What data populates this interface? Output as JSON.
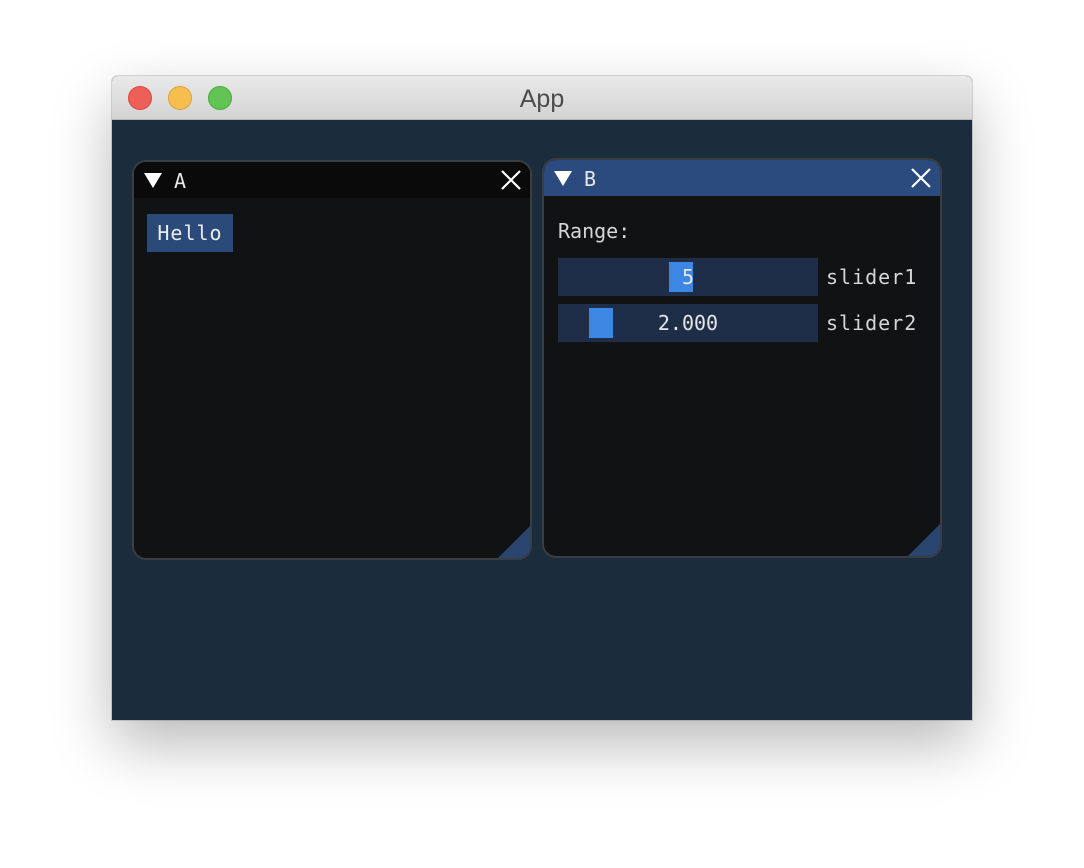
{
  "app": {
    "title": "App"
  },
  "window_controls": [
    "close",
    "minimize",
    "maximize"
  ],
  "colors": {
    "background": "#1b2d3c",
    "window_bg": "#111214",
    "title_active": "#2b4a7d",
    "title_inactive": "#0a0a0a",
    "button": "#2a4a79",
    "slider_frame": "#1e2e48",
    "slider_grab": "#3d86e1"
  },
  "windows": {
    "a": {
      "title": "A",
      "button_label": "Hello"
    },
    "b": {
      "title": "B",
      "range_label": "Range:",
      "slider1": {
        "label": "slider1",
        "value_text": "5",
        "fraction": 0.47
      },
      "slider2": {
        "label": "slider2",
        "value_text": "2.000",
        "fraction": 0.12
      }
    }
  },
  "icons": {
    "collapse": "triangle-down-icon",
    "close": "close-icon",
    "resize": "resize-grip-icon"
  }
}
